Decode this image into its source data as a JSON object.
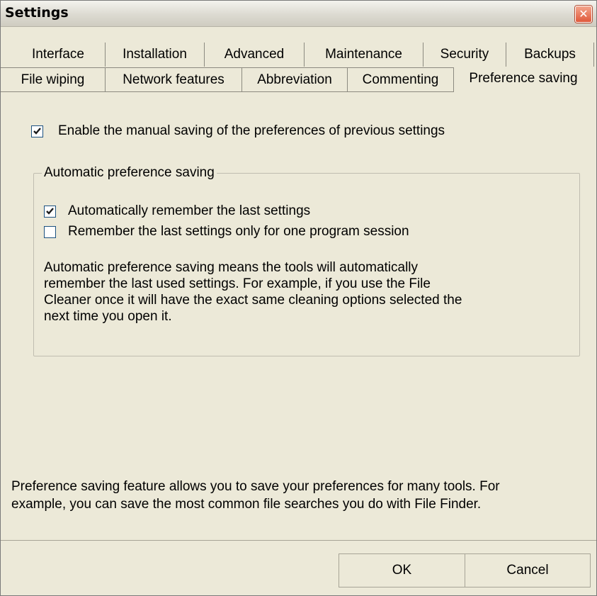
{
  "window": {
    "title": "Settings",
    "close_glyph": "✕"
  },
  "tabs_row1": [
    {
      "label": "Interface"
    },
    {
      "label": "Installation"
    },
    {
      "label": "Advanced"
    },
    {
      "label": "Maintenance"
    },
    {
      "label": "Security"
    },
    {
      "label": "Backups"
    }
  ],
  "tabs_row2": [
    {
      "label": "File wiping"
    },
    {
      "label": "Network features"
    },
    {
      "label": "Abbreviation"
    },
    {
      "label": "Commenting"
    },
    {
      "label": "Preference saving",
      "active": true
    }
  ],
  "options": {
    "manual_saving": {
      "label": "Enable the manual saving of the preferences of previous settings",
      "checked": true
    }
  },
  "group": {
    "title": "Automatic preference saving",
    "remember_last": {
      "label": "Automatically remember the last settings",
      "checked": true
    },
    "session_only": {
      "label": "Remember the last settings only for one program session",
      "checked": false
    },
    "description": [
      "Automatic preference saving means the tools will automatically",
      "remember the last used settings. For example, if you use the File",
      "Cleaner once it will have the exact same cleaning options selected the",
      "next time you open it."
    ]
  },
  "footer_note": [
    "Preference saving feature allows you to save your preferences for many tools. For",
    "example, you can save the most common file searches you do with File Finder."
  ],
  "buttons": {
    "ok": "OK",
    "cancel": "Cancel"
  },
  "icons": {
    "close": "close-icon",
    "check": "check-icon"
  },
  "colors": {
    "face": "#ece9d8",
    "close_button": "#e0583a",
    "checkbox_border": "#1c5180"
  }
}
